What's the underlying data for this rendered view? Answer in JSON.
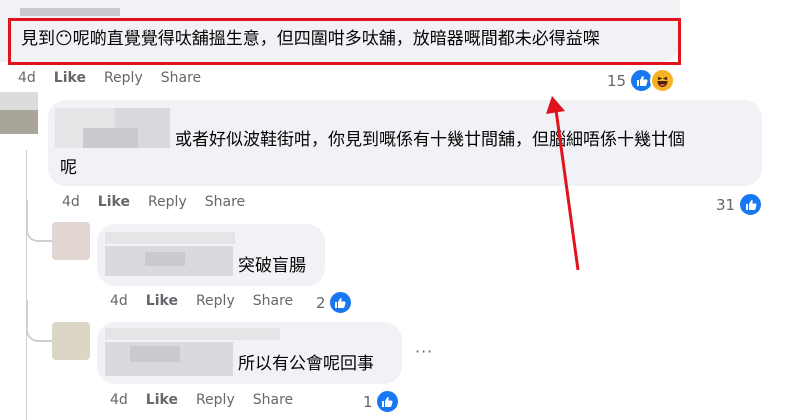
{
  "comments": [
    {
      "text": "見到😶呢啲直覺覺得呔舖搵生意，但四圍咁多呔舖，放暗器嘅間都未必得益㗎",
      "actions": {
        "time": "4d",
        "like": "Like",
        "reply": "Reply",
        "share": "Share"
      },
      "reactions": {
        "count": "15",
        "types": [
          "like-icon",
          "haha-icon"
        ]
      }
    },
    {
      "text_line1": "或者好似波鞋街咁，你見到嘅係有十幾廿間舖，但腦細唔係十幾廿個",
      "text_line2": "呢",
      "actions": {
        "time": "4d",
        "like": "Like",
        "reply": "Reply",
        "share": "Share"
      },
      "reactions": {
        "count": "31",
        "types": [
          "like-icon"
        ]
      }
    },
    {
      "text": "突破盲腸",
      "actions": {
        "time": "4d",
        "like": "Like",
        "reply": "Reply",
        "share": "Share"
      },
      "reactions": {
        "count": "2",
        "types": [
          "like-icon"
        ]
      }
    },
    {
      "text": "所以有公會呢回事",
      "more": "···",
      "actions": {
        "time": "4d",
        "like": "Like",
        "reply": "Reply",
        "share": "Share"
      },
      "reactions": {
        "count": "1",
        "types": [
          "like-icon"
        ]
      }
    }
  ],
  "colors": {
    "highlight": "#e0141c",
    "like_blue": "#1877f2",
    "bubble": "#f0f2f5",
    "meta_gray": "#65676b"
  }
}
